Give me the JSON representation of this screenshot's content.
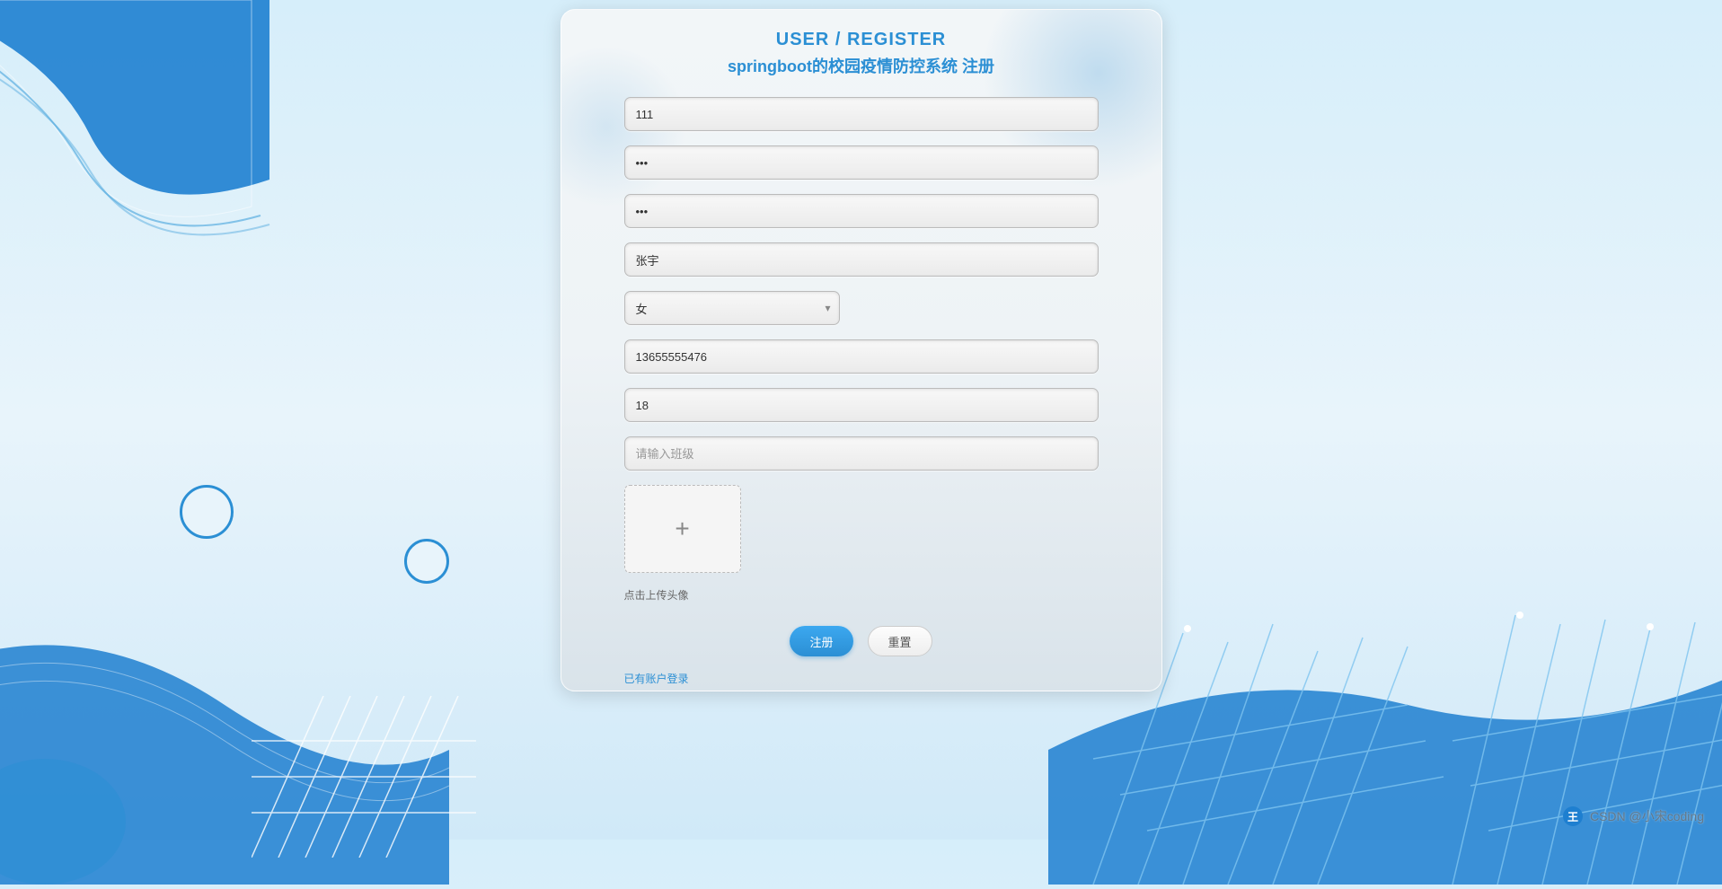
{
  "header": {
    "title_main": "USER / REGISTER",
    "title_sub": "springboot的校园疫情防控系统 注册"
  },
  "form": {
    "username": {
      "value": "111"
    },
    "password": {
      "value": "•••"
    },
    "confirm_password": {
      "value": "•••"
    },
    "realname": {
      "value": "张宇"
    },
    "gender": {
      "selected": "女"
    },
    "phone": {
      "value": "13655555476"
    },
    "age": {
      "value": "18"
    },
    "class": {
      "value": "",
      "placeholder": "请输入班级"
    },
    "upload": {
      "label": "点击上传头像"
    },
    "buttons": {
      "submit": "注册",
      "reset": "重置"
    },
    "login_link": "已有账户登录"
  },
  "watermark": {
    "badge": "王",
    "text": "CSDN @小宋coding"
  }
}
